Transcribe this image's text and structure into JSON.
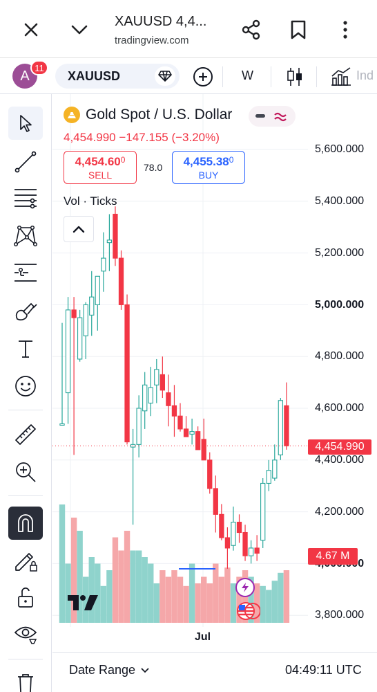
{
  "browser": {
    "title": "XAUUSD 4,4...",
    "url": "tradingview.com"
  },
  "header": {
    "avatar_letter": "A",
    "notification_count": "11",
    "symbol": "XAUUSD",
    "interval": "W",
    "indicators_label": "Ind"
  },
  "legend": {
    "name": "Gold Spot / U.S. Dollar",
    "price_line": "4,454.990  −147.155 (−3.20%)",
    "sell_price_main": "4,454.60",
    "sell_price_small": "0",
    "sell_label": "SELL",
    "spread": "78.0",
    "buy_price_main": "4,455.38",
    "buy_price_small": "0",
    "buy_label": "BUY",
    "vol_label": "Vol · Ticks"
  },
  "price_axis": {
    "ticks": [
      "5,600.000",
      "5,400.000",
      "5,200.000",
      "5,000.000",
      "4,800.000",
      "4,600.000",
      "4,400.000",
      "4,200.000",
      "4,000.000",
      "3,800.000"
    ],
    "current_price": "4,454.990",
    "volume_tag": "4.67 M"
  },
  "time_axis": {
    "label": "Jul"
  },
  "footer": {
    "date_range": "Date Range",
    "time": "04:49:11 UTC"
  },
  "colors": {
    "up": "#26a69a",
    "down": "#f23645",
    "up_volume": "#8fd3cc",
    "down_volume": "#f5a7a9",
    "accent": "#2962ff"
  },
  "chart_data": {
    "type": "candlestick",
    "ylim": [
      3760,
      5690
    ],
    "current_price": 4454.99,
    "candles": [
      {
        "o": 4540,
        "h": 4930,
        "l": 4540,
        "c": 4540
      },
      {
        "o": 4660,
        "h": 5030,
        "l": 4540,
        "c": 4980
      },
      {
        "o": 4980,
        "h": 5030,
        "l": 4420,
        "c": 4950
      },
      {
        "o": 4790,
        "h": 4980,
        "l": 4780,
        "c": 4950
      },
      {
        "o": 4880,
        "h": 5010,
        "l": 4790,
        "c": 5000
      },
      {
        "o": 4960,
        "h": 5130,
        "l": 4880,
        "c": 5030
      },
      {
        "o": 5000,
        "h": 5090,
        "l": 4900,
        "c": 5110
      },
      {
        "o": 5130,
        "h": 5280,
        "l": 5050,
        "c": 5180
      },
      {
        "o": 5240,
        "h": 5350,
        "l": 5130,
        "c": 5250
      },
      {
        "o": 5350,
        "h": 5380,
        "l": 5150,
        "c": 5180
      },
      {
        "o": 5180,
        "h": 5210,
        "l": 4980,
        "c": 5000
      },
      {
        "o": 5000,
        "h": 5040,
        "l": 4460,
        "c": 4470
      },
      {
        "o": 4450,
        "h": 4520,
        "l": 4150,
        "c": 4460
      },
      {
        "o": 4460,
        "h": 4650,
        "l": 4410,
        "c": 4600
      },
      {
        "o": 4590,
        "h": 4740,
        "l": 4520,
        "c": 4690
      },
      {
        "o": 4620,
        "h": 4760,
        "l": 4570,
        "c": 4680
      },
      {
        "o": 4690,
        "h": 4790,
        "l": 4620,
        "c": 4750
      },
      {
        "o": 4730,
        "h": 4800,
        "l": 4640,
        "c": 4670
      },
      {
        "o": 4660,
        "h": 4730,
        "l": 4530,
        "c": 4610
      },
      {
        "o": 4610,
        "h": 4690,
        "l": 4490,
        "c": 4570
      },
      {
        "o": 4570,
        "h": 4620,
        "l": 4510,
        "c": 4520
      },
      {
        "o": 4520,
        "h": 4570,
        "l": 4490,
        "c": 4490
      },
      {
        "o": 4500,
        "h": 4560,
        "l": 4460,
        "c": 4510
      },
      {
        "o": 4510,
        "h": 4530,
        "l": 4440,
        "c": 4440
      },
      {
        "o": 4480,
        "h": 4560,
        "l": 4400,
        "c": 4400
      },
      {
        "o": 4400,
        "h": 4430,
        "l": 4270,
        "c": 4290
      },
      {
        "o": 4290,
        "h": 4340,
        "l": 4120,
        "c": 4190
      },
      {
        "o": 4190,
        "h": 4230,
        "l": 4090,
        "c": 4100
      },
      {
        "o": 4100,
        "h": 4140,
        "l": 3980,
        "c": 4060
      },
      {
        "o": 4070,
        "h": 4220,
        "l": 4050,
        "c": 4160
      },
      {
        "o": 4160,
        "h": 4190,
        "l": 4080,
        "c": 4120
      },
      {
        "o": 4120,
        "h": 4150,
        "l": 4010,
        "c": 4030
      },
      {
        "o": 4030,
        "h": 4090,
        "l": 4000,
        "c": 4060
      },
      {
        "o": 4060,
        "h": 4110,
        "l": 4010,
        "c": 4040
      },
      {
        "o": 4090,
        "h": 4330,
        "l": 4060,
        "c": 4310
      },
      {
        "o": 4310,
        "h": 4400,
        "l": 4280,
        "c": 4360
      },
      {
        "o": 4330,
        "h": 4460,
        "l": 4320,
        "c": 4400
      },
      {
        "o": 4420,
        "h": 4640,
        "l": 4400,
        "c": 4630
      },
      {
        "o": 4610,
        "h": 4700,
        "l": 4440,
        "c": 4455
      }
    ],
    "volume_relative": [
      0.9,
      0.45,
      0.8,
      0.7,
      0.35,
      0.5,
      0.45,
      0.28,
      0.4,
      0.65,
      0.55,
      0.7,
      0.55,
      0.55,
      0.5,
      0.45,
      0.3,
      0.4,
      0.35,
      0.4,
      0.35,
      0.28,
      0.45,
      0.3,
      0.35,
      0.3,
      0.45,
      0.35,
      0.42,
      0.3,
      0.35,
      0.4,
      0.35,
      0.3,
      0.28,
      0.25,
      0.32,
      0.38,
      0.4
    ]
  }
}
